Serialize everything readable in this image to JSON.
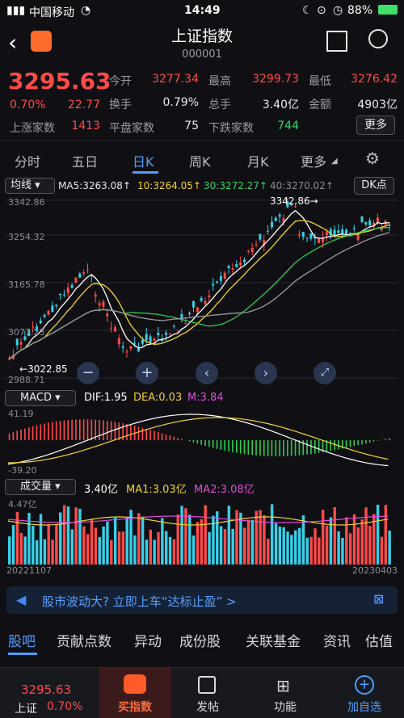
{
  "status": {
    "carrier": "中国移动",
    "time": "14:49",
    "battery": "88%"
  },
  "header": {
    "title": "上证指数",
    "code": "000001"
  },
  "quote": {
    "price": "3295.63",
    "change_pct": "0.70%",
    "change": "22.77",
    "open_label": "今开",
    "open": "3277.34",
    "high_label": "最高",
    "high": "3299.73",
    "low_label": "最低",
    "low": "3276.42",
    "turnover_label": "换手",
    "turnover": "0.79%",
    "volume_label": "总手",
    "volume": "3.40亿",
    "amount_label": "金额",
    "amount": "4903亿",
    "up_label": "上涨家数",
    "up": "1413",
    "flat_label": "平盘家数",
    "flat": "75",
    "down_label": "下跌家数",
    "down": "744",
    "more": "更多"
  },
  "tabs": [
    "分时",
    "五日",
    "日K",
    "周K",
    "月K",
    "更多"
  ],
  "ma_bar": {
    "selector": "均线",
    "ma5": "MA5:3263.08↑",
    "ma10": "10:3264.05↑",
    "ma30": "30:3272.27↑",
    "ma40": "40:3270.02↑",
    "dk": "DK点"
  },
  "kline": {
    "y_labels": [
      "3342.86",
      "3254.32",
      "3165.78",
      "3077.23",
      "2988.71"
    ],
    "high_mark": "3342.86",
    "low_mark": "3022.85"
  },
  "macd": {
    "selector": "MACD",
    "dif": "DIF:1.95",
    "dea": "DEA:0.03",
    "m": "M:3.84",
    "top": "41.19",
    "bottom": "-39.20"
  },
  "vol": {
    "selector": "成交量",
    "v": "3.40亿",
    "ma1": "MA1:3.03亿",
    "ma2": "MA2:3.08亿",
    "top": "4.47亿",
    "start": "20221107",
    "end": "20230403"
  },
  "banner": {
    "text": "股市波动大? 立即上车“达标止盈” >"
  },
  "section_tabs": [
    "股吧",
    "贡献点数",
    "异动",
    "成份股",
    "关联基金",
    "资讯",
    "估值"
  ],
  "bottom": {
    "price": "3295.63",
    "name": "上证",
    "pct": "0.70%",
    "buy": "买指数",
    "post": "发帖",
    "func": "功能",
    "add": "加自选"
  },
  "colors": {
    "up": "#ff4a4a",
    "down": "#37d0ea",
    "accent": "#4b9fff"
  }
}
